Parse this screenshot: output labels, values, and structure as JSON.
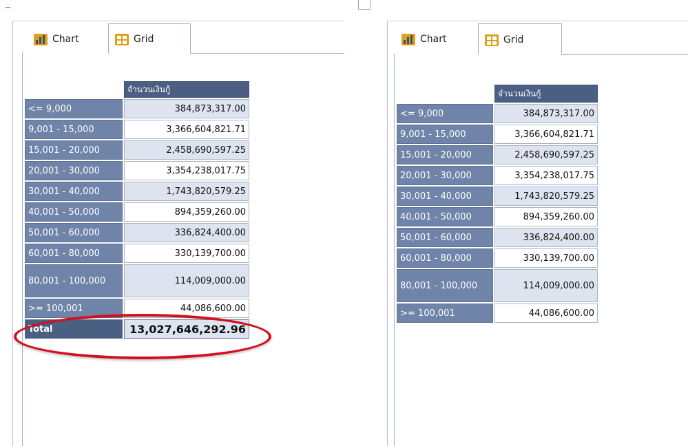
{
  "left_panel": {
    "tabs": [
      {
        "label": "Chart",
        "icon": "chart-icon"
      },
      {
        "label": "Grid",
        "icon": "grid-icon"
      }
    ],
    "active_tab": "Grid",
    "grid": {
      "measure_header": "จำนวนเงินกู้",
      "rows": [
        {
          "label": "<= 9,000",
          "value": "384,873,317.00"
        },
        {
          "label": "9,001 - 15,000",
          "value": "3,366,604,821.71"
        },
        {
          "label": "15,001 - 20,000",
          "value": "2,458,690,597.25"
        },
        {
          "label": "20,001 - 30,000",
          "value": "3,354,238,017.75"
        },
        {
          "label": "30,001 - 40,000",
          "value": "1,743,820,579.25"
        },
        {
          "label": "40,001 - 50,000",
          "value": "894,359,260.00"
        },
        {
          "label": "50,001 - 60,000",
          "value": "336,824,400.00"
        },
        {
          "label": "60,001 - 80,000",
          "value": "330,139,700.00"
        },
        {
          "label": "80,001 - 100,000",
          "value": "114,009,000.00"
        },
        {
          "label": ">= 100,001",
          "value": "44,086,600.00"
        }
      ],
      "total": {
        "label": "Total",
        "value": "13,027,646,292.96"
      }
    },
    "highlight_color": "#d40e1c"
  },
  "right_panel": {
    "tabs": [
      {
        "label": "Chart",
        "icon": "chart-icon"
      },
      {
        "label": "Grid",
        "icon": "grid-icon"
      }
    ],
    "active_tab": "Grid",
    "grid": {
      "measure_header": "จำนวนเงินกู้",
      "rows": [
        {
          "label": "<= 9,000",
          "value": "384,873,317.00"
        },
        {
          "label": "9,001 - 15,000",
          "value": "3,366,604,821.71"
        },
        {
          "label": "15,001 - 20,000",
          "value": "2,458,690,597.25"
        },
        {
          "label": "20,001 - 30,000",
          "value": "3,354,238,017.75"
        },
        {
          "label": "30,001 - 40,000",
          "value": "1,743,820,579.25"
        },
        {
          "label": "40,001 - 50,000",
          "value": "894,359,260.00"
        },
        {
          "label": "50,001 - 60,000",
          "value": "336,824,400.00"
        },
        {
          "label": "60,001 - 80,000",
          "value": "330,139,700.00"
        },
        {
          "label": "80,001 - 100,000",
          "value": "114,009,000.00"
        },
        {
          "label": ">= 100,001",
          "value": "44,086,600.00"
        }
      ]
    }
  },
  "colors": {
    "header_bg": "#4a5f82",
    "row_label_bg": "#6f84a8",
    "alt_row_bg": "#dde4ef"
  }
}
